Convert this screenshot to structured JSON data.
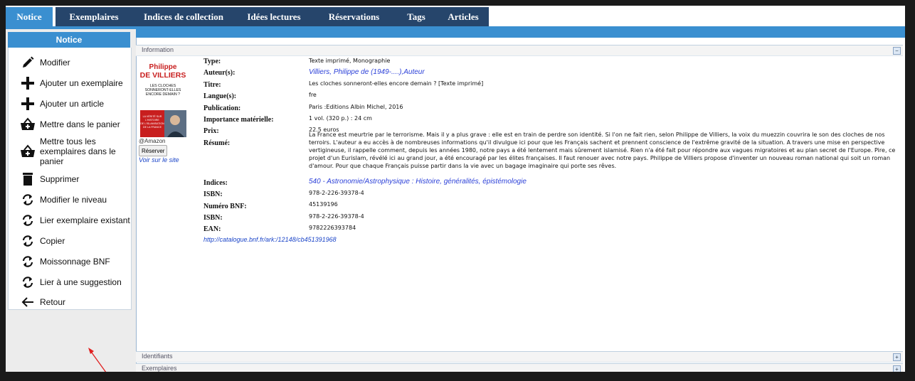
{
  "tabs": [
    "Notice",
    "Exemplaires",
    "Indices de collection",
    "Idées lectures",
    "Réservations",
    "Tags",
    "Articles"
  ],
  "sidebar": {
    "title": "Notice",
    "items": [
      {
        "label": "Modifier",
        "icon": "pencil-icon"
      },
      {
        "label": "Ajouter un exemplaire",
        "icon": "plus-icon"
      },
      {
        "label": "Ajouter un article",
        "icon": "plus-icon"
      },
      {
        "label": "Mettre dans le panier",
        "icon": "basket-icon"
      },
      {
        "label": "Mettre tous les exemplaires dans le panier",
        "icon": "basket-icon"
      },
      {
        "label": "Supprimer",
        "icon": "trash-icon"
      },
      {
        "label": "Modifier le niveau",
        "icon": "refresh-icon"
      },
      {
        "label": "Lier exemplaire existant",
        "icon": "refresh-icon"
      },
      {
        "label": "Copier",
        "icon": "refresh-icon"
      },
      {
        "label": "Moissonnage BNF",
        "icon": "refresh-icon"
      },
      {
        "label": "Lier à une suggestion",
        "icon": "refresh-icon"
      },
      {
        "label": "Retour",
        "icon": "arrow-left-icon"
      }
    ]
  },
  "sections": {
    "information": "Information",
    "identifiants": "Identifiants",
    "exemplaires": "Exemplaires"
  },
  "cover": {
    "author_line1": "Philippe",
    "author_line2": "DE VILLIERS",
    "title": "LES CLOCHES SONNERONT-ELLES ENCORE DEMAIN ?",
    "banner": "LA VÉRITÉ SUR L'HISTOIRE DE L'ISLAMISATION DE LA FRANCE",
    "source": "@Amazon",
    "reserve_button": "Réserver",
    "site_link": "Voir sur le site"
  },
  "fields": {
    "type": {
      "label": "Type:",
      "value": "Texte imprimé, Monographie"
    },
    "auteurs": {
      "label": "Auteur(s):",
      "value": "Villiers, Philippe de (1949-....),Auteur"
    },
    "titre": {
      "label": "Titre:",
      "value": "Les cloches sonneront-elles encore demain ? [Texte imprimé]"
    },
    "langue": {
      "label": "Langue(s):",
      "value": "fre"
    },
    "publication": {
      "label": "Publication:",
      "value": "Paris :Editions Albin Michel, 2016"
    },
    "importance": {
      "label": "Importance matérielle:",
      "value": "1 vol. (320 p.) : 24 cm"
    },
    "prix": {
      "label": "Prix:",
      "value": "22.5 euros"
    },
    "resume": {
      "label": "Résumé:",
      "value": "La France est meurtrie par le terrorisme. Mais il y a plus grave : elle est en train de perdre son identité. Si l'on ne fait rien, selon Philippe de Villiers, la voix du muezzin couvrira le son des cloches de nos terroirs. L'auteur a eu accès à de nombreuses informations qu'il divulgue ici pour que les Français sachent et prennent conscience de l'extrême gravité de la situation. A travers une mise en perspective vertigineuse, il rappelle comment, depuis les années 1980, notre pays a été lentement mais sûrement islamisé. Rien n'a été fait pour répondre aux vagues migratoires et au plan secret de l'Europe. Pire, ce projet d'un Eurislam, révélé ici au grand jour, a été encouragé par les élites françaises. Il faut renouer avec notre pays. Philippe de Villiers propose d'inventer un nouveau roman national qui soit un roman d'amour. Pour que chaque Français puisse partir dans la vie avec un bagage imaginaire qui porte ses rêves."
    },
    "indices": {
      "label": "Indices:",
      "value": "540 - Astronomie/Astrophysique : Histoire, généralités, épistémologie"
    },
    "isbn1": {
      "label": "ISBN:",
      "value": "978-2-226-39378-4"
    },
    "bnf": {
      "label": "Numéro BNF:",
      "value": "45139196"
    },
    "isbn2": {
      "label": "ISBN:",
      "value": "978-2-226-39378-4"
    },
    "ean": {
      "label": "EAN:",
      "value": "9782226393784"
    }
  },
  "catalogue_url": "http://catalogue.bnf.fr/ark:/12148/cb451391968",
  "colors": {
    "tab_bg": "#26456b",
    "accent": "#3a8fd0",
    "link": "#2a3fd8",
    "annotation_arrow": "#e02020"
  }
}
